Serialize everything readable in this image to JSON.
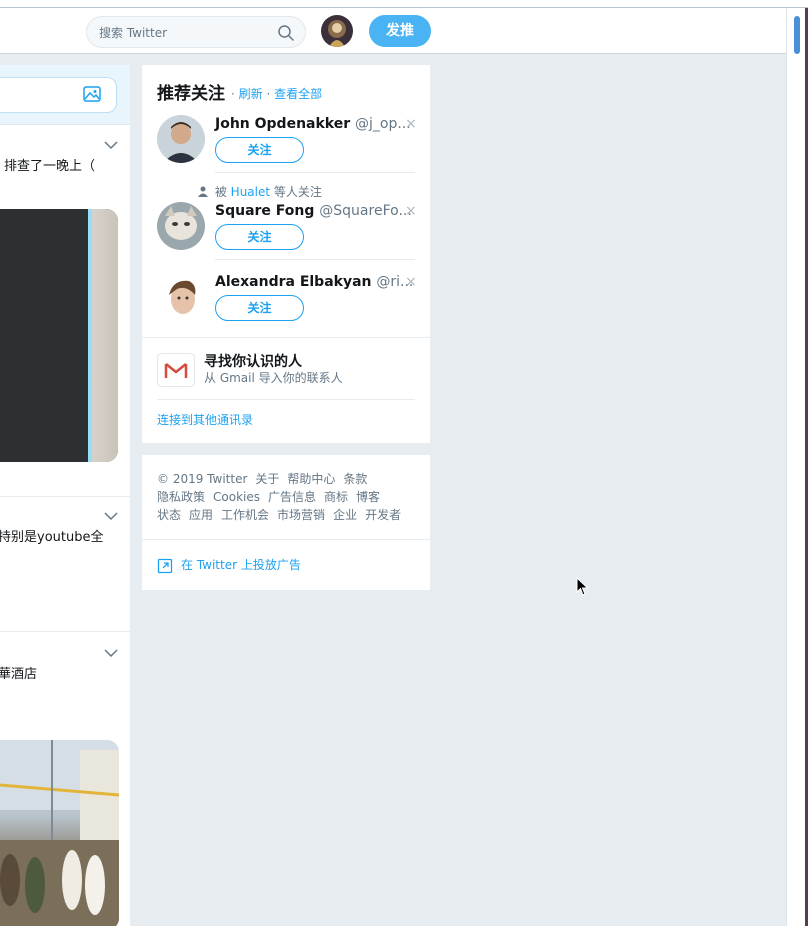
{
  "navbar": {
    "search_placeholder": "搜索 Twitter",
    "tweet_button": "发推"
  },
  "timeline": {
    "tweets": [
      {
        "text": "排查了一晚上（"
      },
      {
        "text": "持别是youtube全"
      },
      {
        "text": "華酒店"
      }
    ]
  },
  "who_to_follow": {
    "title": "推荐关注",
    "refresh": "刷新",
    "view_all": "查看全部",
    "dot": "·",
    "users": [
      {
        "name": "John Opdenakker",
        "handle": "@j_op...",
        "follow": "关注",
        "dismiss": "×"
      },
      {
        "name": "Square Fong",
        "handle": "@SquareFo...",
        "follow": "关注",
        "dismiss": "×",
        "social_prefix": "被",
        "social_link": "Hualet",
        "social_suffix": "等人关注"
      },
      {
        "name": "Alexandra Elbakyan",
        "handle": "@ri...",
        "follow": "关注",
        "dismiss": "×"
      }
    ],
    "find_people": {
      "title": "寻找你认识的人",
      "subtitle": "从 Gmail 导入你的联系人"
    },
    "connect_other": "连接到其他通讯录"
  },
  "footer": {
    "links": [
      "© 2019 Twitter",
      "关于",
      "帮助中心",
      "条款",
      "隐私政策",
      "Cookies",
      "广告信息",
      "商标",
      "博客",
      "状态",
      "应用",
      "工作机会",
      "市场营销",
      "企业",
      "开发者"
    ],
    "advertise": "在 Twitter 上投放广告"
  },
  "colors": {
    "accent": "#1da1f2",
    "tweet_button": "#4ab3f4",
    "background": "#e6ecf0"
  }
}
